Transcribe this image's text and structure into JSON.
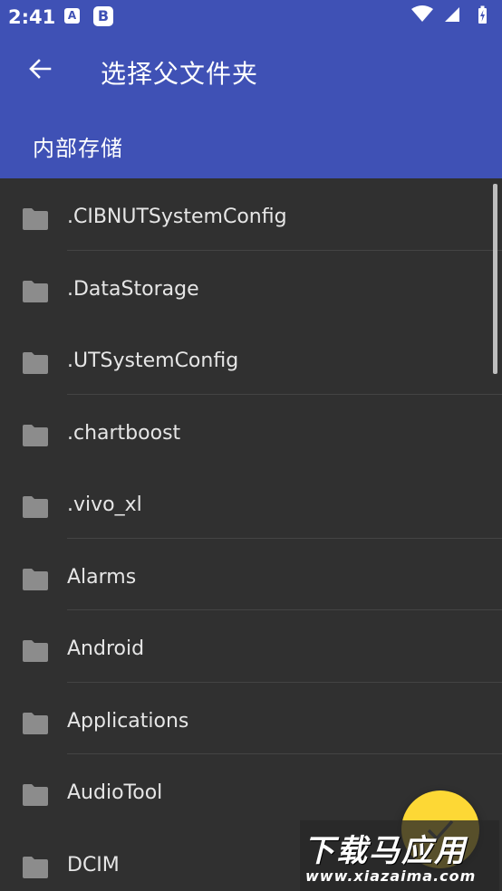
{
  "status_bar": {
    "time": "2:41",
    "notif_a": "A",
    "notif_b": "B"
  },
  "toolbar": {
    "title": "选择父文件夹"
  },
  "path": {
    "current": "内部存储"
  },
  "folders": [
    ".CIBNUTSystemConfig",
    ".DataStorage",
    ".UTSystemConfig",
    ".chartboost",
    ".vivo_xl",
    "Alarms",
    "Android",
    "Applications",
    "AudioTool",
    "DCIM"
  ],
  "watermark": {
    "title": "下载马应用",
    "url": "www.xiazaima.com"
  },
  "colors": {
    "primary": "#3f51b5",
    "background": "#303030",
    "fab": "#fdd835"
  }
}
